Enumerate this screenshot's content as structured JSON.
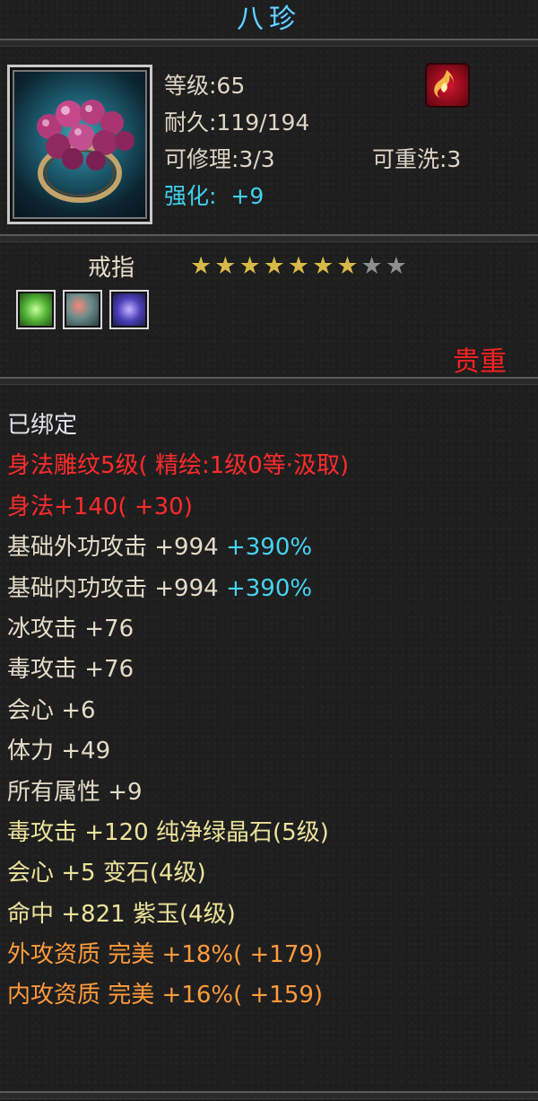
{
  "title": "八珍",
  "info": {
    "level": "等级:65",
    "durability": "耐久:119/194",
    "repairable": "可修理:3/3",
    "rewash": "可重洗:3",
    "enhance_label": "强化: ",
    "enhance_value": "+9"
  },
  "item_type": "戒指",
  "stars": {
    "filled": 7,
    "total": 9
  },
  "rarity": "贵重",
  "gem_icons": [
    "green-gem-icon",
    "red-gem-icon",
    "purple-gem-icon"
  ],
  "stats": {
    "bound": "已绑定",
    "engrave": "身法雕纹5级( 精绘:1级0等·汲取)",
    "agility": "身法+140( +30)",
    "ext_atk": {
      "text": "基础外功攻击 +994",
      "pct": "+390%"
    },
    "int_atk": {
      "text": "基础内功攻击 +994",
      "pct": "+390%"
    },
    "ice": "冰攻击 +76",
    "poison": "毒攻击 +76",
    "crit": "会心 +6",
    "stamina": "体力 +49",
    "all_attr": "所有属性 +9",
    "gem1": {
      "stat": "毒攻击 +120",
      "gem": "纯净绿晶石(5级)"
    },
    "gem2": {
      "stat": "会心 +5",
      "gem": "变石(4级)"
    },
    "gem3": {
      "stat": "命中 +821",
      "gem": "紫玉(4级)"
    },
    "ext_quality": "外攻资质  完美 +18%( +179)",
    "int_quality": "内攻资质  完美 +16%( +159)"
  },
  "colors": {
    "title": "#6fd0ff",
    "enhance": "#3fd2f0",
    "rarity": "#ff2020",
    "engrave": "#ff2b2b",
    "gem_stat": "#ece39a",
    "quality": "#ff9b3c",
    "percent": "#45d4f2"
  }
}
